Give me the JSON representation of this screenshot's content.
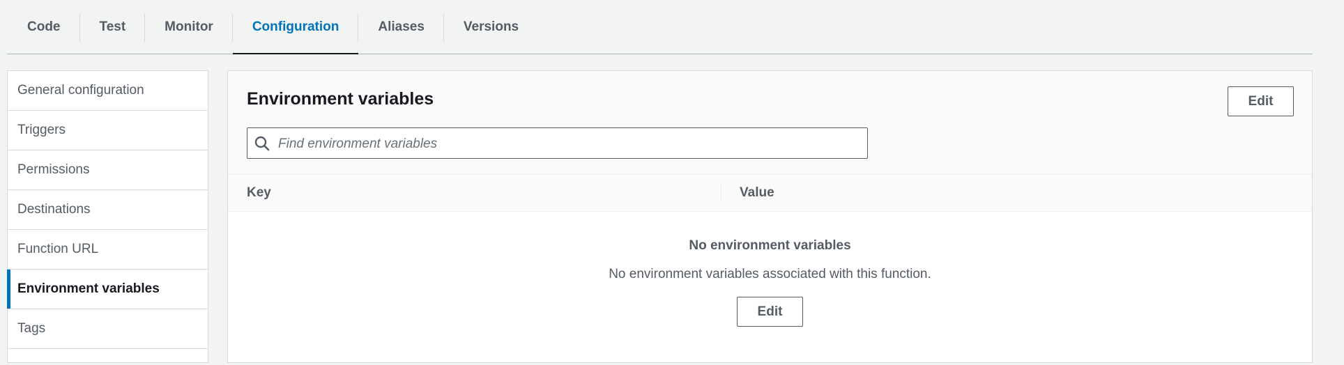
{
  "tabs": [
    {
      "label": "Code"
    },
    {
      "label": "Test"
    },
    {
      "label": "Monitor"
    },
    {
      "label": "Configuration",
      "active": true
    },
    {
      "label": "Aliases"
    },
    {
      "label": "Versions"
    }
  ],
  "sidebar": {
    "items": [
      {
        "label": "General configuration"
      },
      {
        "label": "Triggers"
      },
      {
        "label": "Permissions"
      },
      {
        "label": "Destinations"
      },
      {
        "label": "Function URL"
      },
      {
        "label": "Environment variables",
        "active": true
      },
      {
        "label": "Tags"
      }
    ]
  },
  "panel": {
    "title": "Environment variables",
    "edit_label": "Edit",
    "search": {
      "placeholder": "Find environment variables",
      "value": "",
      "icon": "search-icon"
    },
    "table": {
      "columns": [
        "Key",
        "Value"
      ],
      "rows": []
    },
    "empty": {
      "title": "No environment variables",
      "description": "No environment variables associated with this function.",
      "edit_label": "Edit"
    }
  },
  "colors": {
    "accent": "#0073bb",
    "text": "#16191f",
    "muted": "#545b64",
    "border": "#d5dbdb",
    "background": "#f2f3f3"
  }
}
